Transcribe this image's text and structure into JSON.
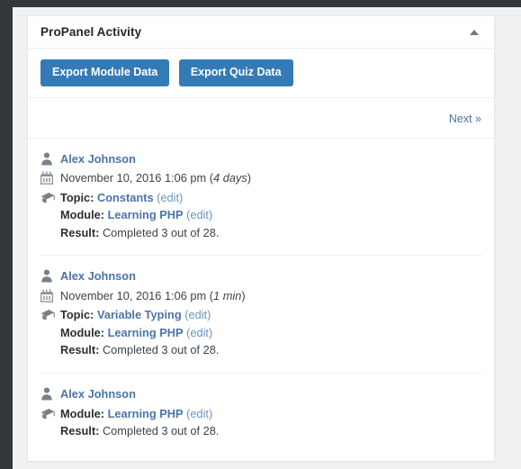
{
  "panel": {
    "title": "ProPanel Activity",
    "toggle_icon": "caret-up-icon",
    "toggle_state": "expanded"
  },
  "toolbar": {
    "buttons": [
      {
        "label": "Export Module Data",
        "name": "export-module-data-button"
      },
      {
        "label": "Export Quiz Data",
        "name": "export-quiz-data-button"
      }
    ]
  },
  "pager": {
    "next_label": "Next »"
  },
  "labels": {
    "topic": "Topic:",
    "module": "Module:",
    "result": "Result:",
    "edit": "(edit)"
  },
  "icons": {
    "user": "user-icon",
    "calendar": "calendar-icon",
    "graduation": "graduation-cap-icon"
  },
  "colors": {
    "accent_button": "#337ab7",
    "link": "#4a74a8",
    "edit_link": "#6a93c0",
    "text": "#3c434a",
    "panel_bg": "#ffffff",
    "page_bg": "#f1f1f1",
    "outer_bg": "#32373c"
  },
  "activities": [
    {
      "user": "Alex Johnson",
      "date": "November 10, 2016 1:06 pm",
      "relative": "4 days",
      "has_date": true,
      "topic": "Constants",
      "has_topic": true,
      "module": "Learning PHP",
      "result": "Completed 3 out of 28."
    },
    {
      "user": "Alex Johnson",
      "date": "November 10, 2016 1:06 pm",
      "relative": "1 min",
      "has_date": true,
      "topic": "Variable Typing",
      "has_topic": true,
      "module": "Learning PHP",
      "result": "Completed 3 out of 28."
    },
    {
      "user": "Alex Johnson",
      "date": "",
      "relative": "",
      "has_date": false,
      "topic": "",
      "has_topic": false,
      "module": "Learning PHP",
      "result": "Completed 3 out of 28."
    }
  ]
}
